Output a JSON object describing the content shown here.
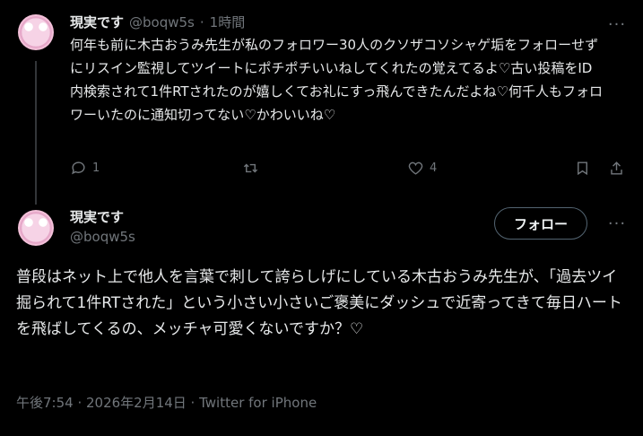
{
  "reply_tweet": {
    "display_name": "現実です",
    "handle": "@boqw5s",
    "separator": "·",
    "time": "1時間",
    "text": "何年も前に木古おうみ先生が私のフォロワー30人のクソザコソシャゲ垢をフォローせずにリスイン監視してツイートにポチポチいいねしてくれたの覚えてるよ♡古い投稿をID内検索されて1件RTされたのが嬉しくてお礼にすっ飛んできたんだよね♡何千人もフォロワーいたのに通知切ってない♡かわいいね♡",
    "reply_count": "1",
    "retweet_count": "",
    "like_count": "4",
    "more_label": "···"
  },
  "main_tweet": {
    "display_name": "現実です",
    "handle": "@boqw5s",
    "follow_label": "フォロー",
    "more_label": "···",
    "text": "普段はネット上で他人を言葉で刺して誇らしげにしている木古おうみ先生が、「過去ツイ掘られて1件RTされた」という小さい小さいご褒美にダッシュで近寄ってきて毎日ハートを飛ばしてくるの、メッチャ可愛くないですか？♡",
    "timestamp": "午後7:54 · 2026年2月14日 · ",
    "client": "Twitter for iPhone"
  },
  "icons": [
    "reply-icon",
    "retweet-icon",
    "like-icon",
    "bookmark-icon",
    "share-icon",
    "more-icon"
  ],
  "colors": {
    "background": "#000000",
    "text": "#e7e9ea",
    "muted": "#71767b",
    "border": "#536471"
  }
}
